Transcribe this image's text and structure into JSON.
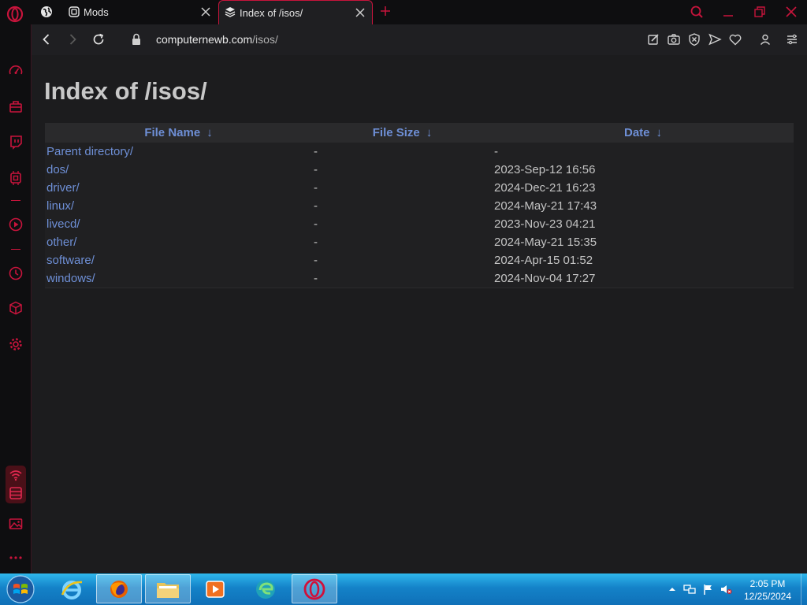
{
  "tabs": [
    {
      "label": "Mods"
    },
    {
      "label": "Index of /isos/"
    }
  ],
  "address": {
    "host": "computernewb.com",
    "path": "/isos/"
  },
  "page": {
    "title": "Index of /isos/",
    "columns": {
      "name": "File Name",
      "size": "File Size",
      "date": "Date",
      "sort_arrow": "↓"
    },
    "rows": [
      {
        "name": "Parent directory/",
        "size": "-",
        "date": "-"
      },
      {
        "name": "dos/",
        "size": "-",
        "date": "2023-Sep-12 16:56"
      },
      {
        "name": "driver/",
        "size": "-",
        "date": "2024-Dec-21 16:23"
      },
      {
        "name": "linux/",
        "size": "-",
        "date": "2024-May-21 17:43"
      },
      {
        "name": "livecd/",
        "size": "-",
        "date": "2023-Nov-23 04:21"
      },
      {
        "name": "other/",
        "size": "-",
        "date": "2024-May-21 15:35"
      },
      {
        "name": "software/",
        "size": "-",
        "date": "2024-Apr-15 01:52"
      },
      {
        "name": "windows/",
        "size": "-",
        "date": "2024-Nov-04 17:27"
      }
    ]
  },
  "taskbar": {
    "time": "2:05 PM",
    "date": "12/25/2024"
  },
  "colors": {
    "accent": "#c8143c",
    "link": "#6e8fd6",
    "background": "#1c1c1e",
    "taskbar": "#1482c8"
  },
  "icons": {
    "sidebar": [
      "speed-dial-icon",
      "shopping-icon",
      "twitch-icon",
      "chip-icon",
      "player-icon",
      "history-icon",
      "box-icon",
      "settings-icon",
      "network-icon",
      "storage-icon",
      "gallery-icon",
      "more-icon"
    ],
    "toolbar": [
      "edit-icon",
      "camera-icon",
      "shield-icon",
      "send-icon",
      "heart-icon",
      "profile-icon",
      "menu-icon"
    ],
    "taskbar": [
      "windows-start-icon",
      "internet-explorer-icon",
      "firefox-icon",
      "file-explorer-icon",
      "media-player-icon",
      "edge-icon",
      "opera-icon"
    ]
  }
}
